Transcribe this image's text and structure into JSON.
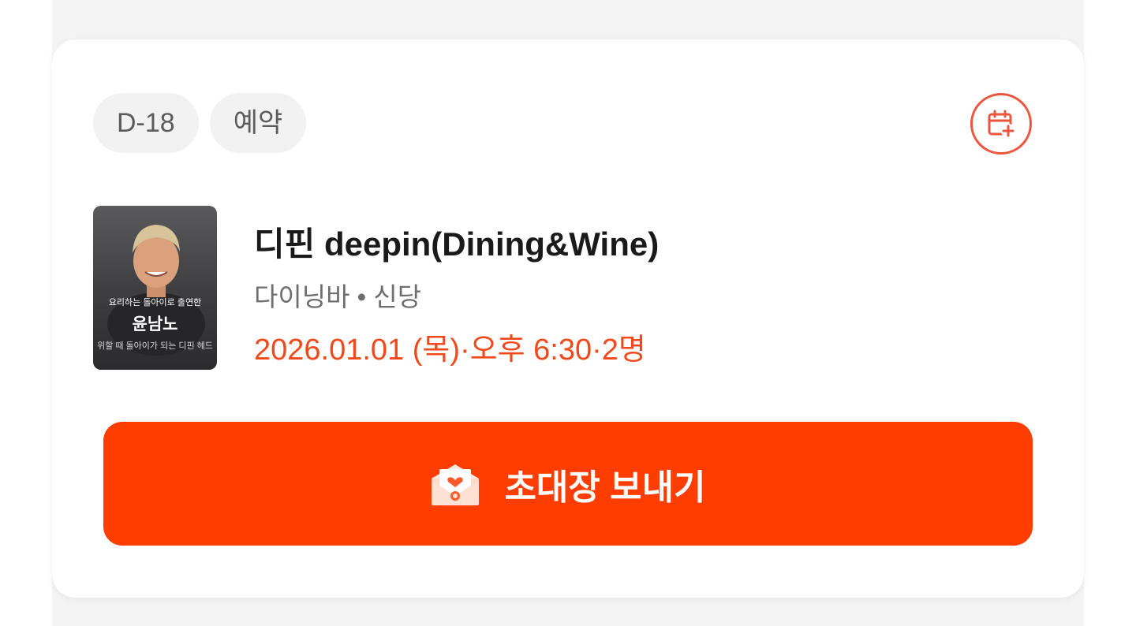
{
  "reservation": {
    "badges": [
      {
        "label": "D-18"
      },
      {
        "label": "예약"
      }
    ],
    "calendar_icon": "calendar-add-icon",
    "thumbnail": {
      "caption": "요리하는 돌아이로 출연한",
      "name": "윤남노",
      "footer": "위할 때 돌아이가 되는 디핀 헤드"
    },
    "restaurant_name": "디핀 deepin(Dining&Wine)",
    "category_location": "다이닝바 • 신당",
    "datetime_party": "2026.01.01 (목)·오후 6:30·2명",
    "invite_button": {
      "label": "초대장 보내기",
      "icon": "envelope-heart-icon"
    },
    "colors": {
      "accent": "#ff3d00",
      "date_text": "#f04a1c",
      "calendar_outline": "#e9573f",
      "badge_bg": "#f2f2f3"
    }
  }
}
